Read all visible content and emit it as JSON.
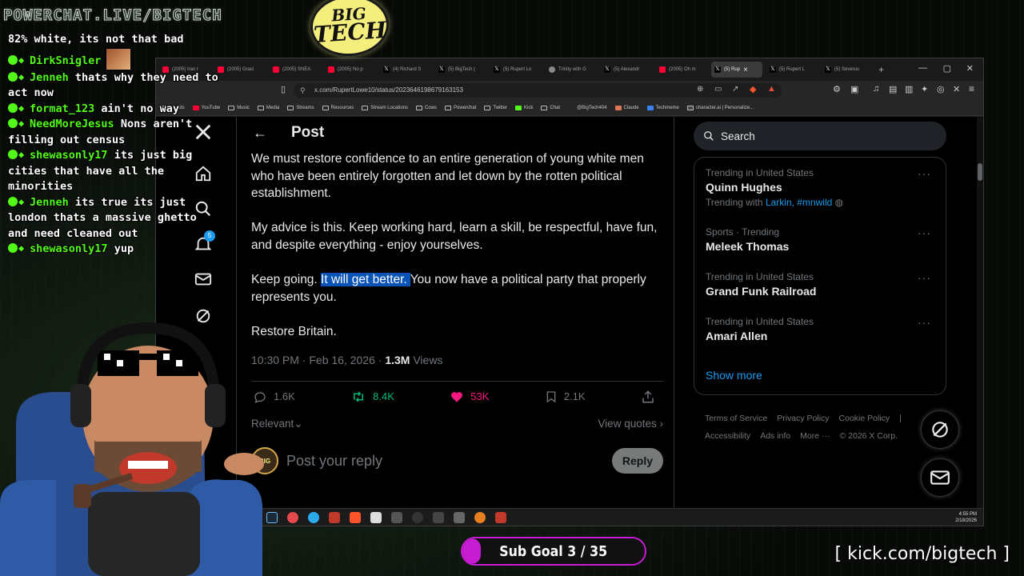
{
  "overlay": {
    "site_banner": "POWERCHAT.LIVE/BIGTECH",
    "logo_line1": "BIG",
    "logo_line2": "TECH",
    "kick_link": "[ kick.com/bigtech ]",
    "sub_goal": {
      "label": "Sub Goal 3 / 35",
      "progress": 0.0857,
      "color": "#c61cd2"
    }
  },
  "chat": {
    "accent": "#53fc18",
    "messages": [
      {
        "user": "",
        "text": "82% white, its not that bad"
      },
      {
        "user": "DirkSnigler",
        "text": ""
      },
      {
        "user": "Jenneh",
        "text": "thats why they need to act now"
      },
      {
        "user": "format_123",
        "text": "ain't no way"
      },
      {
        "user": "NeedMoreJesus",
        "text": "Nons aren't filling out census"
      },
      {
        "user": "shewasonly17",
        "text": "its just big cities that have all the minorities"
      },
      {
        "user": "Jenneh",
        "text": "its true its just london thats a massive ghetto and need cleaned out"
      },
      {
        "user": "shewasonly17",
        "text": "yup"
      }
    ]
  },
  "browser": {
    "tabs": [
      {
        "label": "(2005) Iran t",
        "icon": "youtube-icon"
      },
      {
        "label": "(2005) Graci",
        "icon": "youtube-icon"
      },
      {
        "label": "(2005) SNEA",
        "icon": "youtube-icon"
      },
      {
        "label": "(2005) No p",
        "icon": "youtube-icon"
      },
      {
        "label": "(4) Richard S",
        "icon": "x-icon"
      },
      {
        "label": "(5) BigTech (",
        "icon": "x-icon"
      },
      {
        "label": "(5) Rupert Lo",
        "icon": "x-icon"
      },
      {
        "label": "Trinity with G",
        "icon": "globe-icon"
      },
      {
        "label": "(5) Alexandr",
        "icon": "x-icon"
      },
      {
        "label": "(2005) Oh m",
        "icon": "youtube-icon"
      },
      {
        "label": "(5) Rup",
        "icon": "x-icon",
        "active": true
      },
      {
        "label": "(5) Rupert L",
        "icon": "x-icon"
      },
      {
        "label": "(5) Severus",
        "icon": "x-icon"
      }
    ],
    "url": "x.com/RupertLowe10/status/2023646198679163153",
    "bookmarks": [
      "Artists",
      "YouTube",
      "Music",
      "Media",
      "Streams",
      "Resources",
      "Stream Locations",
      "Cows",
      "Powerchat",
      "Twitter",
      "Kick",
      "Chat",
      "@BigTech404",
      "Claude",
      "Techmeme",
      "character.ai | Personalize..."
    ],
    "clock_time": "4:55 PM",
    "clock_date": "2/18/2026"
  },
  "post": {
    "header_title": "Post",
    "para1": "We must restore confidence to an entire generation of young white men who have been entirely forgotten and let down by the rotten political establishment.",
    "para2": "My advice is this. Keep working hard, learn a skill, be respectful, have fun, and despite everything - enjoy yourselves.",
    "para3_a": "Keep going. ",
    "para3_selected": "It will get better. ",
    "para3_b": "You now have a political party that properly represents you.",
    "para4": "Restore Britain.",
    "time": "10:30 PM · Feb 16, 2026 · ",
    "views_count": "1.3M",
    "views_label": " Views",
    "replies": "1.6K",
    "reposts": "8.4K",
    "likes": "53K",
    "bookmarks": "2.1K",
    "sort_label": "Relevant",
    "view_quotes": "View quotes",
    "reply_placeholder": "Post your reply",
    "reply_button": "Reply"
  },
  "sidebar": {
    "search_placeholder": "Search",
    "trends": [
      {
        "context": "Trending in United States",
        "name": "Quinn Hughes",
        "with_prefix": "Trending with ",
        "with_links": "Larkin, #mnwild"
      },
      {
        "context": "Sports · Trending",
        "name": "Meleek Thomas"
      },
      {
        "context": "Trending in United States",
        "name": "Grand Funk Railroad"
      },
      {
        "context": "Trending in United States",
        "name": "Amari Allen"
      }
    ],
    "show_more": "Show more",
    "footer": [
      "Terms of Service",
      "Privacy Policy",
      "Cookie Policy",
      "|",
      "Accessibility",
      "Ads info",
      "More ···",
      "© 2026 X Corp."
    ]
  }
}
